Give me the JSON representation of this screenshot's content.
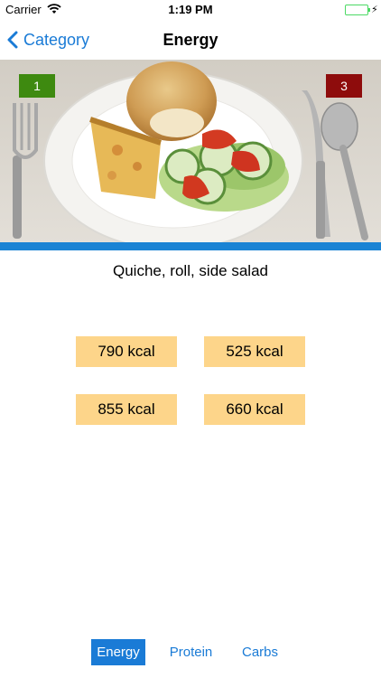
{
  "status_bar": {
    "carrier": "Carrier",
    "time": "1:19 PM",
    "battery_level": 1.0
  },
  "nav": {
    "back_label": "Category",
    "title": "Energy"
  },
  "photo": {
    "left_badge": "1",
    "right_badge": "3",
    "left_badge_color": "#3e8a10",
    "right_badge_color": "#8e0c0c",
    "strip_color": "#1a83d4"
  },
  "meal": {
    "name": "Quiche, roll, side salad"
  },
  "answers": [
    "790 kcal",
    "525 kcal",
    "855 kcal",
    "660 kcal"
  ],
  "tabs": {
    "energy": "Energy",
    "protein": "Protein",
    "carbs": "Carbs",
    "active": "Energy"
  },
  "colors": {
    "accent": "#1a7bd6",
    "answer_bg": "#fdd58a"
  }
}
